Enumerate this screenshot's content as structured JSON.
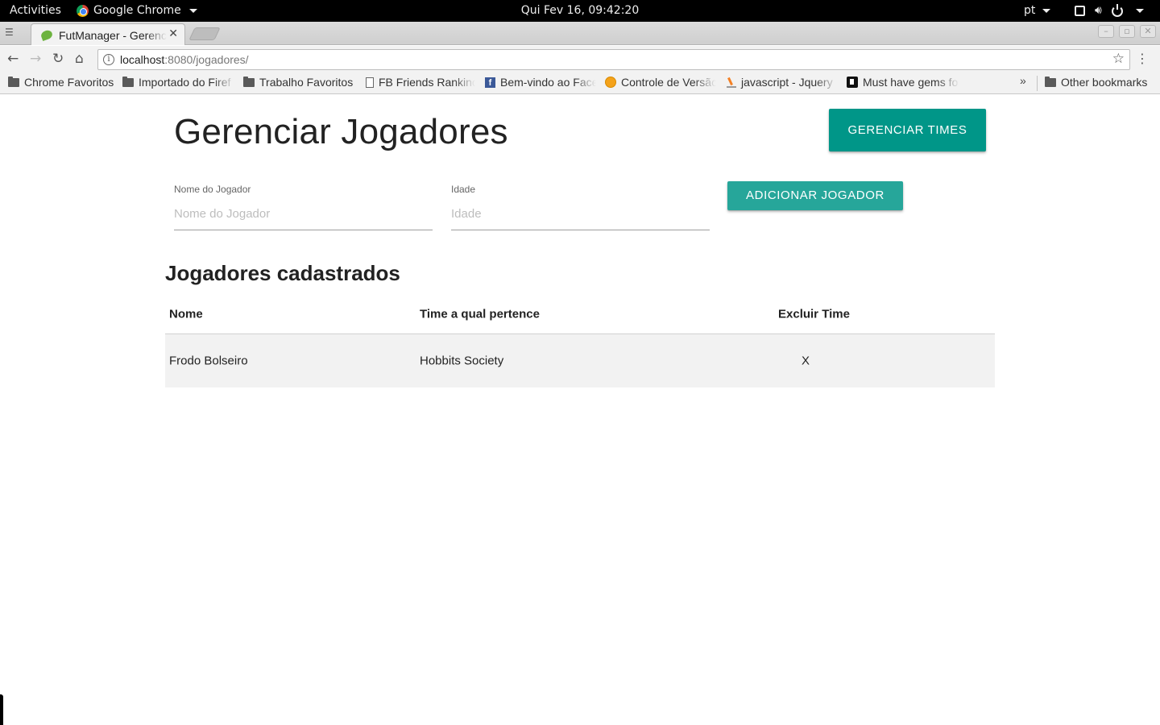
{
  "topbar": {
    "activities": "Activities",
    "app_name": "Google Chrome",
    "clock": "Qui Fev 16, 09:42:20",
    "lang": "pt"
  },
  "browser": {
    "tab_title": "FutManager - Gerenc",
    "url_host": "localhost",
    "url_rest": ":8080/jogadores/",
    "bookmarks": [
      {
        "label": "Chrome Favoritos",
        "icon": "folder-icon"
      },
      {
        "label": "Importado do Firef",
        "icon": "folder-icon"
      },
      {
        "label": "Trabalho Favoritos",
        "icon": "folder-icon"
      },
      {
        "label": "FB Friends Rankinc",
        "icon": "page-icon"
      },
      {
        "label": "Bem-vindo ao Face",
        "icon": "facebook-icon"
      },
      {
        "label": "Controle de Versão",
        "icon": "globe-icon"
      },
      {
        "label": "javascript - Jquery",
        "icon": "stackoverflow-icon"
      },
      {
        "label": "Must have gems fo",
        "icon": "gem-icon"
      }
    ],
    "more_bookmarks": "»",
    "other_bookmarks": "Other bookmarks"
  },
  "page": {
    "title": "Gerenciar Jogadores",
    "manage_teams_button": "Gerenciar Times",
    "form": {
      "name_label": "Nome do Jogador",
      "name_placeholder": "Nome do Jogador",
      "name_value": "",
      "age_label": "Idade",
      "age_placeholder": "Idade",
      "age_value": "",
      "add_button": "Adicionar Jogador"
    },
    "list_title": "Jogadores cadastrados",
    "table": {
      "headers": [
        "Nome",
        "Time a qual pertence",
        "Excluir Time"
      ],
      "rows": [
        {
          "name": "Frodo Bolseiro",
          "team": "Hobbits Society",
          "delete": "X"
        }
      ]
    },
    "accent_color": "#009688"
  }
}
